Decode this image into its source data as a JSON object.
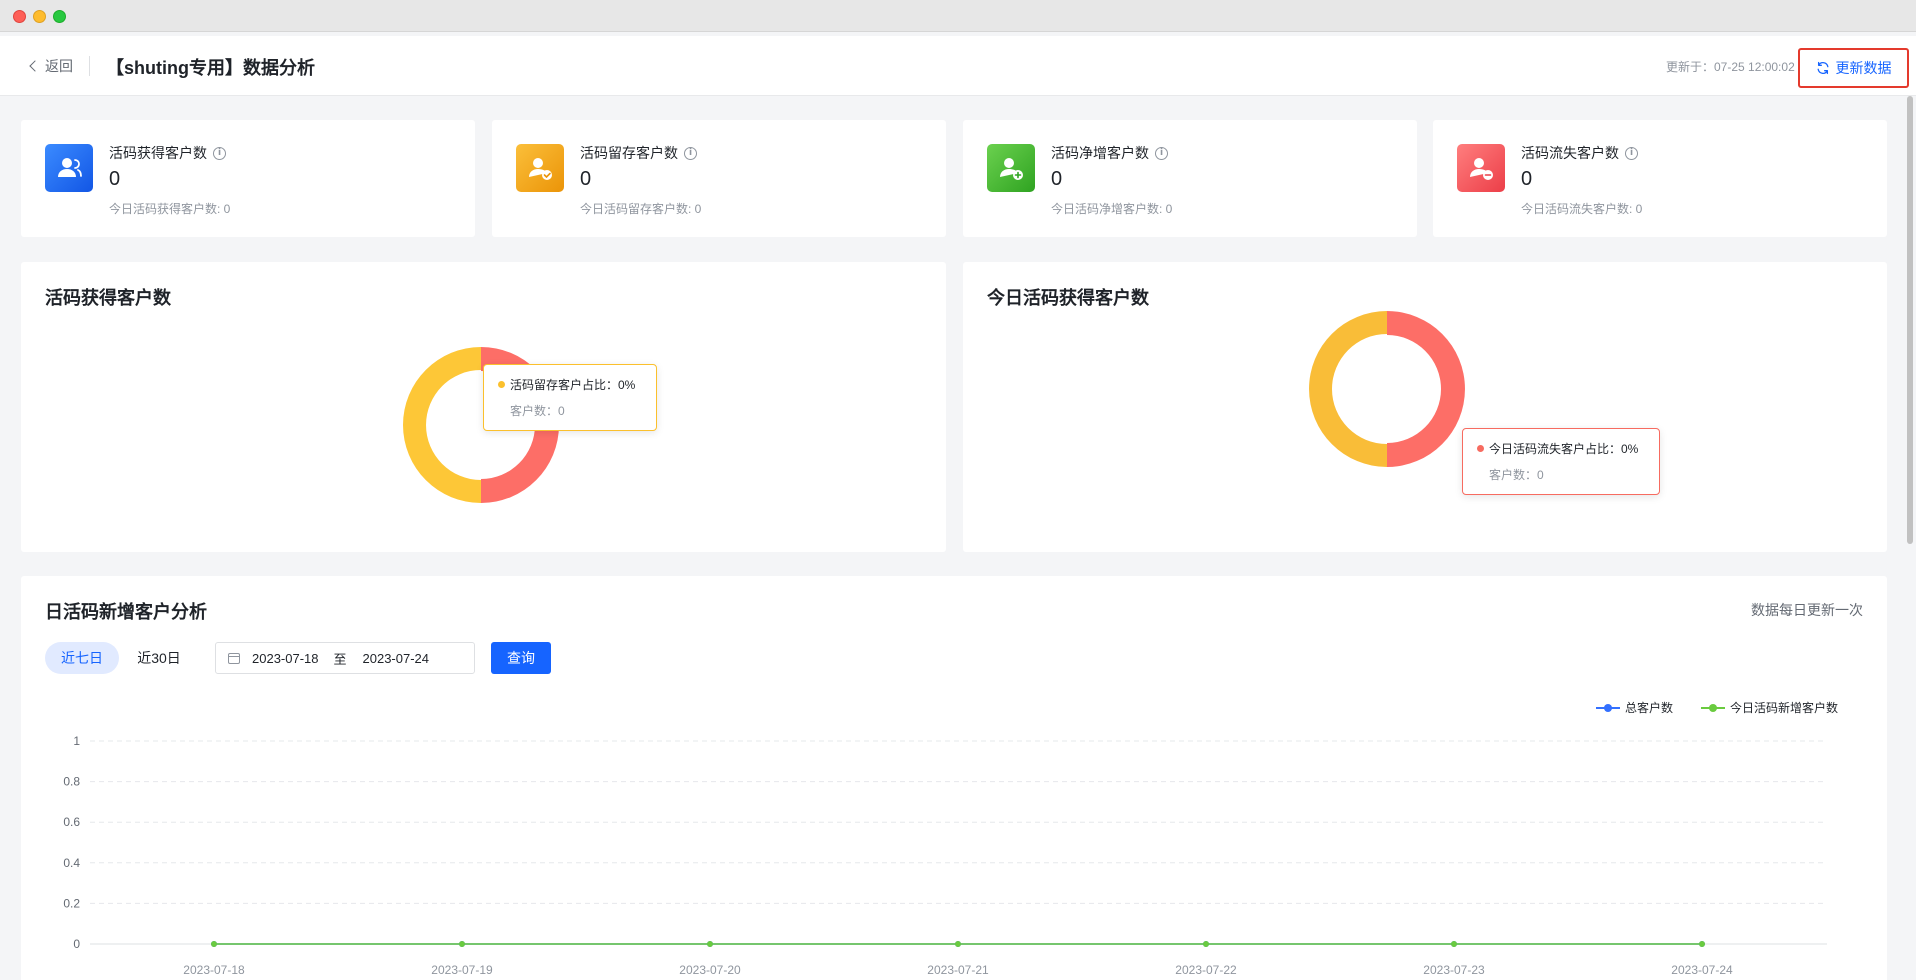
{
  "header": {
    "back_label": "返回",
    "title": "【shuting专用】数据分析",
    "updated_text": "更新于：07-25 12:00:02",
    "refresh_label": "更新数据"
  },
  "stats": [
    {
      "label": "活码获得客户数",
      "value": "0",
      "sub": "今日活码获得客户数: 0",
      "icon": "user-icon",
      "color": "#1f6cf5"
    },
    {
      "label": "活码留存客户数",
      "value": "0",
      "sub": "今日活码留存客户数: 0",
      "icon": "user-check-icon",
      "color": "#f0a316"
    },
    {
      "label": "活码净增客户数",
      "value": "0",
      "sub": "今日活码净增客户数: 0",
      "icon": "user-add-icon",
      "color": "#41b52f"
    },
    {
      "label": "活码流失客户数",
      "value": "0",
      "sub": "今日活码流失客户数: 0",
      "icon": "user-remove-icon",
      "color": "#f2545b"
    }
  ],
  "donut_left": {
    "title": "活码获得客户数",
    "tooltip_title": "活码留存客户占比：0%",
    "tooltip_sub": "客户数：0",
    "tooltip_color": "#fbc02d"
  },
  "donut_right": {
    "title": "今日活码获得客户数",
    "tooltip_title": "今日活码流失客户占比：0%",
    "tooltip_sub": "客户数：0",
    "tooltip_color": "#f76b60"
  },
  "analysis": {
    "title": "日活码新增客户分析",
    "note": "数据每日更新一次",
    "tab_7": "近七日",
    "tab_30": "近30日",
    "date_start": "2023-07-18",
    "date_sep": "至",
    "date_end": "2023-07-24",
    "query_label": "查询"
  },
  "chart_data": {
    "type": "line",
    "x": [
      "2023-07-18",
      "2023-07-19",
      "2023-07-20",
      "2023-07-21",
      "2023-07-22",
      "2023-07-23",
      "2023-07-24"
    ],
    "series": [
      {
        "name": "总客户数",
        "values": [
          0,
          0,
          0,
          0,
          0,
          0,
          0
        ],
        "color": "#3370ff"
      },
      {
        "name": "今日活码新增客户数",
        "values": [
          0,
          0,
          0,
          0,
          0,
          0,
          0
        ],
        "color": "#6acb3f"
      }
    ],
    "ylim": [
      0,
      1
    ],
    "yticks": [
      "0",
      "0.2",
      "0.4",
      "0.6",
      "0.8",
      "1"
    ],
    "grid": true,
    "legend": "top-right"
  },
  "colors": {
    "accent": "#1664ff",
    "donut_yellow": "#fdc737",
    "donut_red": "#fd6e67",
    "highlight_border": "#e43a2d"
  }
}
